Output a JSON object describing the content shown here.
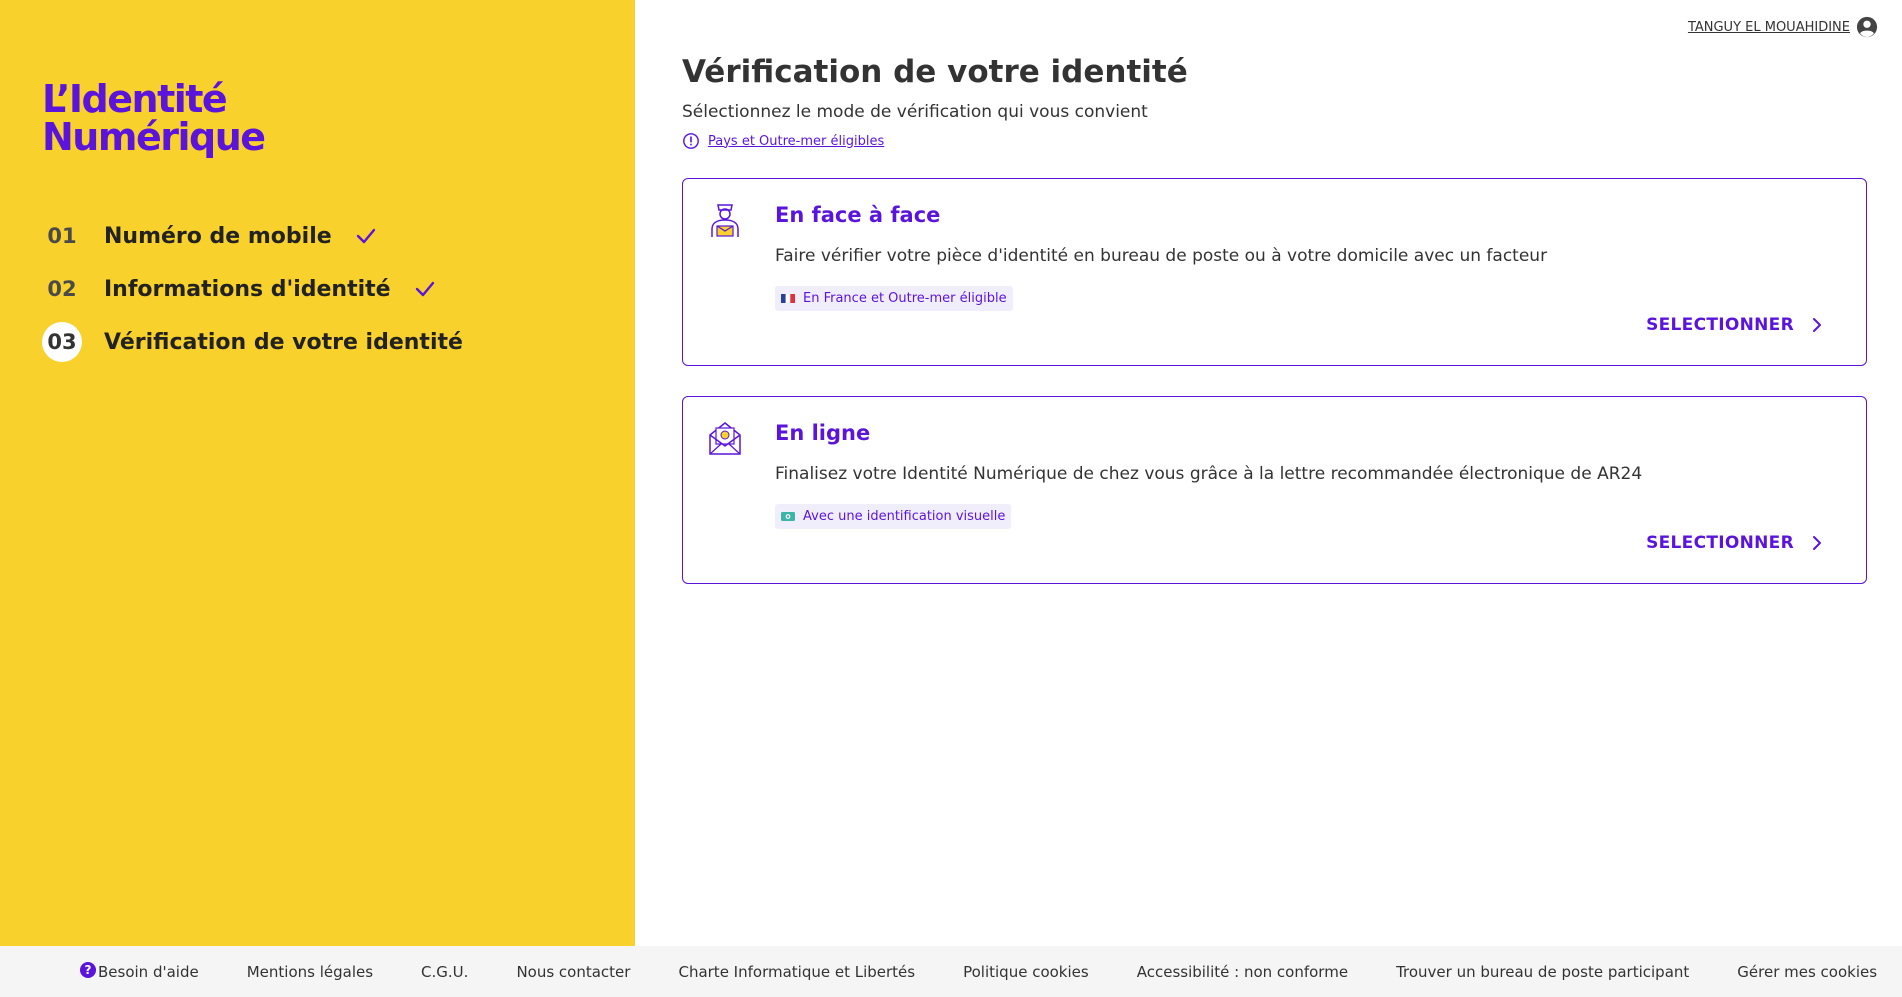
{
  "brand": {
    "line1": "L’Identité",
    "line2": "Numérique",
    "color": "#5a14db",
    "sidebar_bg": "#f9d12c"
  },
  "user": {
    "name": "TANGUY EL MOUAHIDINE",
    "icon": "user-circle-icon"
  },
  "steps": [
    {
      "number": "01",
      "label": "Numéro de mobile",
      "done": true
    },
    {
      "number": "02",
      "label": "Informations d'identité",
      "done": true
    },
    {
      "number": "03",
      "label": "Vérification de votre identité",
      "current": true
    }
  ],
  "main": {
    "title": "Vérification de votre identité",
    "subtitle": "Sélectionnez le mode de vérification qui vous convient",
    "notice_link": "Pays et Outre-mer éligibles"
  },
  "cards": [
    {
      "title": "En face à face",
      "description": "Faire vérifier votre pièce d'identité en bureau de poste ou à votre domicile avec un facteur",
      "tag": "En France et Outre-mer éligible",
      "tag_icon": "france-flag-icon",
      "icon": "postman-icon",
      "action": "SELECTIONNER"
    },
    {
      "title": "En ligne",
      "description": "Finalisez votre Identité Numérique de chez vous grâce à la lettre recommandée électronique de AR24",
      "tag": "Avec une identification visuelle",
      "tag_icon": "camera-icon",
      "icon": "envelope-icon",
      "action": "SELECTIONNER"
    }
  ],
  "footer": [
    {
      "label": "Besoin d'aide",
      "icon": "help-icon"
    },
    {
      "label": "Mentions légales"
    },
    {
      "label": "C.G.U."
    },
    {
      "label": "Nous contacter"
    },
    {
      "label": "Charte Informatique et Libertés"
    },
    {
      "label": "Politique cookies"
    },
    {
      "label": "Accessibilité : non conforme"
    },
    {
      "label": "Trouver un bureau de poste participant"
    },
    {
      "label": "Gérer mes cookies"
    }
  ]
}
